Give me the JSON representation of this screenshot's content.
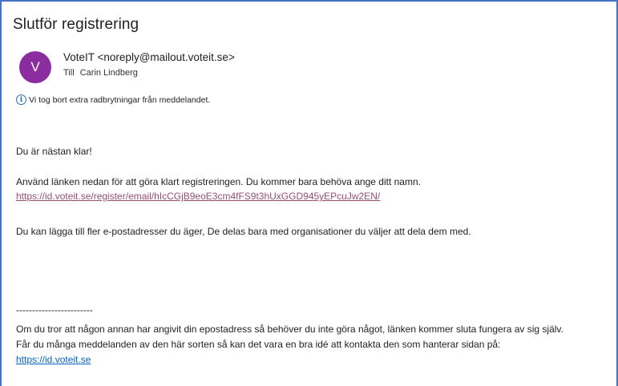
{
  "email": {
    "subject": "Slutför registrering",
    "avatar_letter": "V",
    "sender": "VoteIT <noreply@mailout.voteit.se>",
    "to_label": "Till",
    "recipient": "Carin Lindberg",
    "info_notice": "Vi tog bort extra radbrytningar från meddelandet."
  },
  "body": {
    "greeting": "Du är nästan klar!",
    "instruction": "Använd länken nedan för att göra klart registreringen. Du kommer bara behöva ange ditt namn.",
    "register_link": "https://id.voteit.se/register/email/hIcCGjB9eoE3cm4fFS9t3hUxGGD945yEPcuJw2EN/",
    "more_addresses": "Du kan lägga till fler e-postadresser du äger, De delas bara med organisationer du väljer att dela dem med.",
    "separator": "------------------------",
    "warning_line1": "Om du tror att någon annan har angivit din epostadress så behöver du inte göra något, länken kommer sluta fungera av sig själv.",
    "warning_line2": "Får du många meddelanden av den här sorten så kan det vara en bra idé att kontakta den som hanterar sidan på:",
    "site_link": "https://id.voteit.se"
  },
  "colors": {
    "avatar_bg": "#8b2d9e",
    "visited_link": "#954f72",
    "link": "#0563c1",
    "frame_border": "#4472c4"
  }
}
